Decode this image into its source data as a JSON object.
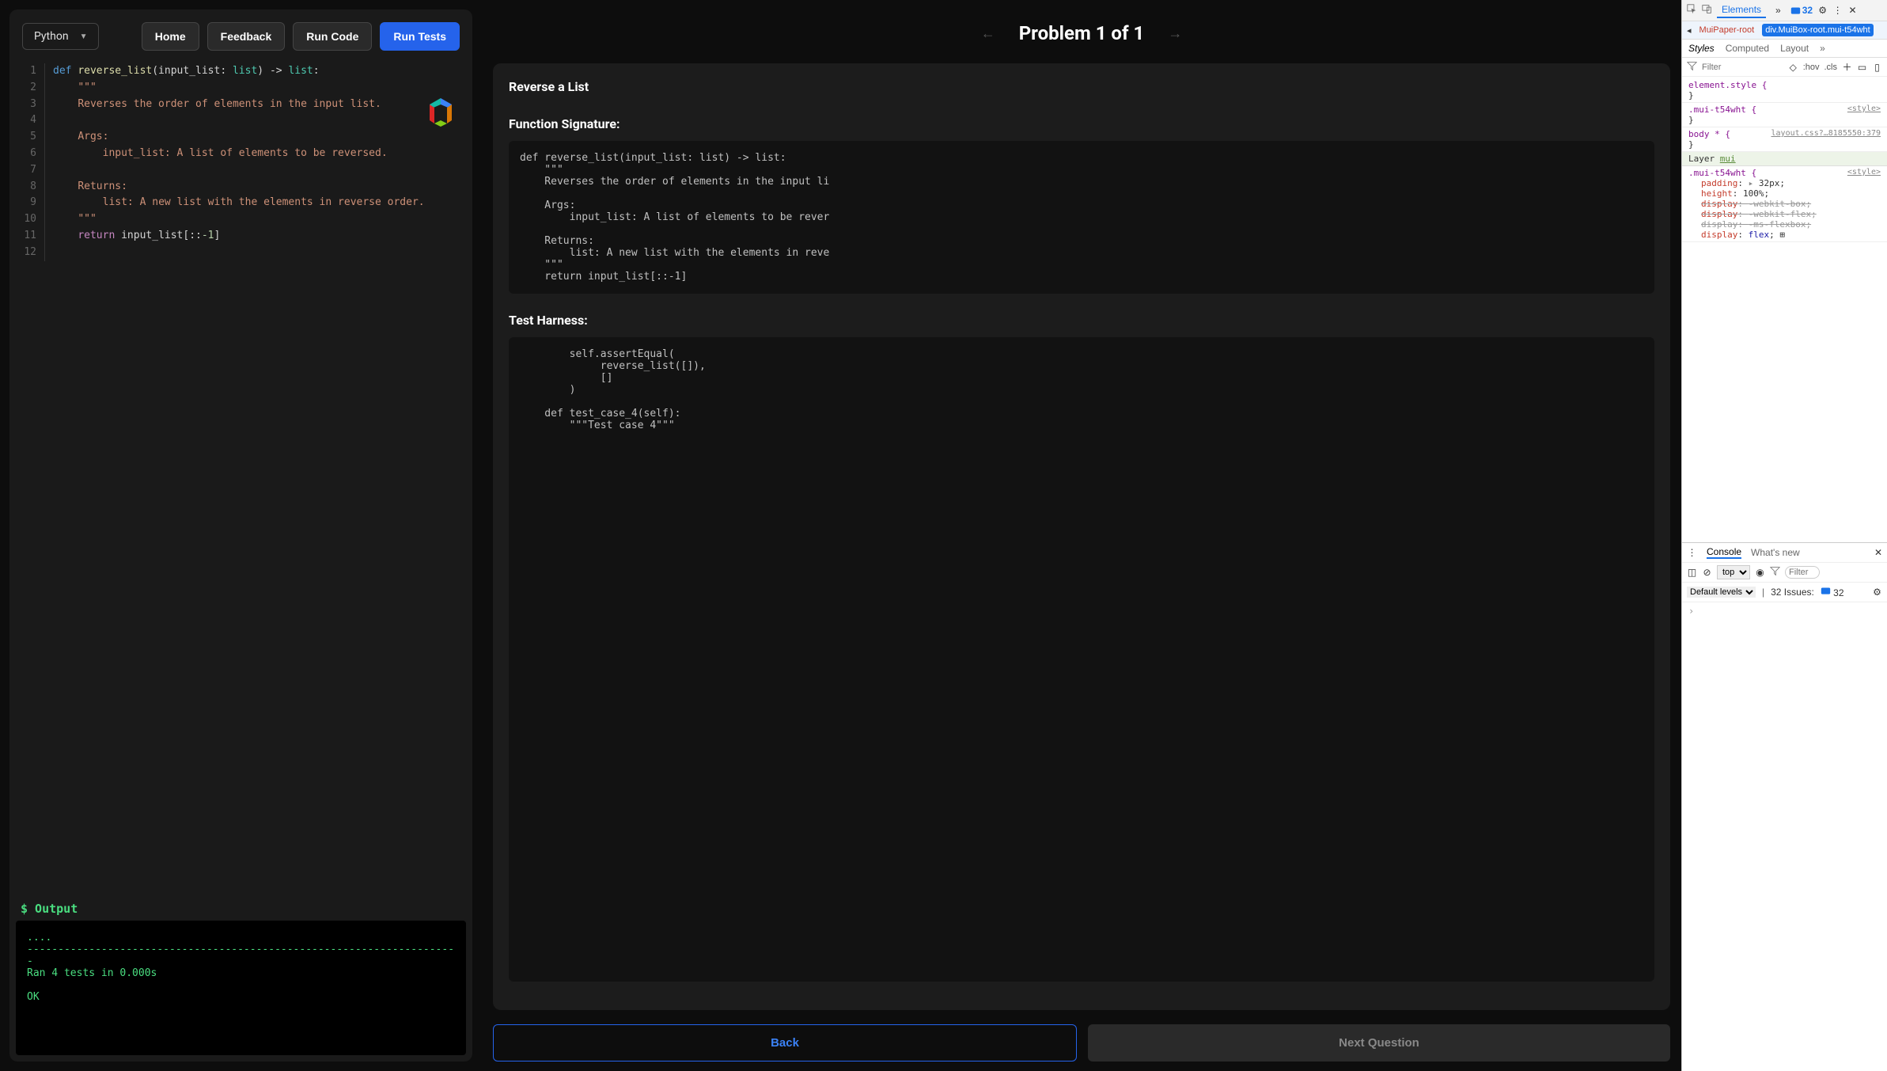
{
  "toolbar": {
    "language": "Python",
    "home": "Home",
    "feedback": "Feedback",
    "runCode": "Run Code",
    "runTests": "Run Tests"
  },
  "editor": {
    "lines": [
      {
        "n": "1",
        "segs": [
          {
            "c": "kdef",
            "t": "def"
          },
          {
            "c": "",
            "t": " "
          },
          {
            "c": "fn",
            "t": "reverse_list"
          },
          {
            "c": "",
            "t": "(input_list: "
          },
          {
            "c": "typ",
            "t": "list"
          },
          {
            "c": "",
            "t": ") -> "
          },
          {
            "c": "typ",
            "t": "list"
          },
          {
            "c": "",
            "t": ":"
          }
        ]
      },
      {
        "n": "2",
        "segs": [
          {
            "c": "",
            "t": "    "
          },
          {
            "c": "str",
            "t": "\"\"\""
          }
        ]
      },
      {
        "n": "3",
        "segs": [
          {
            "c": "",
            "t": "    "
          },
          {
            "c": "str",
            "t": "Reverses the order of elements in the input list."
          }
        ]
      },
      {
        "n": "4",
        "segs": [
          {
            "c": "",
            "t": ""
          }
        ]
      },
      {
        "n": "5",
        "segs": [
          {
            "c": "",
            "t": "    "
          },
          {
            "c": "str",
            "t": "Args:"
          }
        ]
      },
      {
        "n": "6",
        "segs": [
          {
            "c": "",
            "t": "        "
          },
          {
            "c": "str",
            "t": "input_list: A list of elements to be reversed."
          }
        ]
      },
      {
        "n": "7",
        "segs": [
          {
            "c": "",
            "t": ""
          }
        ]
      },
      {
        "n": "8",
        "segs": [
          {
            "c": "",
            "t": "    "
          },
          {
            "c": "str",
            "t": "Returns:"
          }
        ]
      },
      {
        "n": "9",
        "segs": [
          {
            "c": "",
            "t": "        "
          },
          {
            "c": "str",
            "t": "list: A new list with the elements in reverse order."
          }
        ]
      },
      {
        "n": "10",
        "segs": [
          {
            "c": "",
            "t": "    "
          },
          {
            "c": "str",
            "t": "\"\"\""
          }
        ]
      },
      {
        "n": "11",
        "segs": [
          {
            "c": "",
            "t": "    "
          },
          {
            "c": "kret",
            "t": "return"
          },
          {
            "c": "",
            "t": " input_list[::"
          },
          {
            "c": "num",
            "t": "-1"
          },
          {
            "c": "",
            "t": "]"
          }
        ]
      },
      {
        "n": "12",
        "segs": [
          {
            "c": "",
            "t": ""
          }
        ]
      }
    ]
  },
  "output": {
    "label": "$ Output",
    "text": "....\n----------------------------------------------------------------------\nRan 4 tests in 0.000s\n\nOK"
  },
  "problem": {
    "navTitle": "Problem 1 of 1",
    "title": "Reverse a List",
    "sigHeader": "Function Signature:",
    "sigCode": "def reverse_list(input_list: list) -> list:\n    \"\"\"\n    Reverses the order of elements in the input li\n\n    Args:\n        input_list: A list of elements to be rever\n\n    Returns:\n        list: A new list with the elements in reve\n    \"\"\"\n    return input_list[::-1]",
    "thHeader": "Test Harness:",
    "thCode": "        self.assertEqual(\n             reverse_list([]),\n             []\n        )\n\n    def test_case_4(self):\n        \"\"\"Test case 4\"\"\"",
    "back": "Back",
    "next": "Next Question"
  },
  "devtools": {
    "tabs": {
      "elements": "Elements",
      "more": "»",
      "issuesCount": "32"
    },
    "breadcrumb": {
      "prev": "MuiPaper-root",
      "current": "div.MuiBox-root.mui-t54wht"
    },
    "subtabs": {
      "styles": "Styles",
      "computed": "Computed",
      "layout": "Layout"
    },
    "filterPlaceholder": "Filter",
    "hov": ":hov",
    "cls": ".cls",
    "rules": {
      "elStyle": "element.style {",
      "classSel": ".mui-t54wht {",
      "styleSrc": "<style>",
      "bodySel": "body * {",
      "bodySrc": "layout.css?…8185550:379",
      "layerLabel": "Layer",
      "layerName": "mui",
      "props": {
        "padding": {
          "name": "padding",
          "val": "32px"
        },
        "height": {
          "name": "height",
          "val": "100%"
        },
        "d1": {
          "name": "display",
          "val": "-webkit-box"
        },
        "d2": {
          "name": "display",
          "val": "-webkit-flex"
        },
        "d3": {
          "name": "display",
          "val": "-ms-flexbox"
        },
        "d4": {
          "name": "display",
          "val": "flex"
        }
      }
    },
    "console": {
      "tab": "Console",
      "whatsNew": "What's new",
      "top": "top",
      "filterPlaceholder": "Filter",
      "levels": "Default levels",
      "issuesLabel": "32 Issues:",
      "issuesCount": "32",
      "prompt": "›"
    }
  }
}
